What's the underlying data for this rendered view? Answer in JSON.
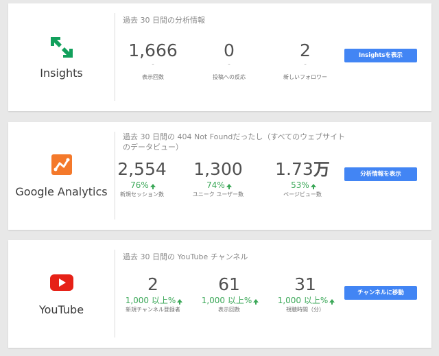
{
  "insights": {
    "name": "Insights",
    "heading": "過去 30 日間の分析情報",
    "stats": [
      {
        "value": "1,666",
        "dash": "-",
        "label": "表示回数"
      },
      {
        "value": "0",
        "dash": "-",
        "label": "投稿への反応"
      },
      {
        "value": "2",
        "dash": "-",
        "label": "新しいフォロワー"
      }
    ],
    "button": "Insightsを表示",
    "icon": "insights-arrows-icon",
    "color": "#12a05c"
  },
  "analytics": {
    "name": "Google Analytics",
    "heading": "過去 30 日間の 404 Not Foundだったし（すべてのウェブサイトのデータビュー）",
    "stats": [
      {
        "value": "2,554",
        "unit": "",
        "change": "76%",
        "label": "新規セッション数"
      },
      {
        "value": "1,300",
        "unit": "",
        "change": "74%",
        "label": "ユニーク ユーザー数"
      },
      {
        "value": "1.73",
        "unit": "万",
        "change": "53%",
        "label": "ページビュー数"
      }
    ],
    "button": "分析情報を表示",
    "icon": "analytics-icon",
    "color": "#f4792b"
  },
  "youtube": {
    "name": "YouTube",
    "heading": "過去 30 日間の YouTube チャンネル",
    "stats": [
      {
        "value": "2",
        "change": "1,000 以上%",
        "label": "新規チャンネル登録者"
      },
      {
        "value": "61",
        "change": "1,000 以上%",
        "label": "表示回数"
      },
      {
        "value": "31",
        "change": "1,000 以上%",
        "label": "視聴時間（分）"
      }
    ],
    "button": "チャンネルに移動",
    "icon": "youtube-play-icon",
    "color": "#e62117"
  },
  "accent": "#4285f4",
  "positive": "#3aa757"
}
